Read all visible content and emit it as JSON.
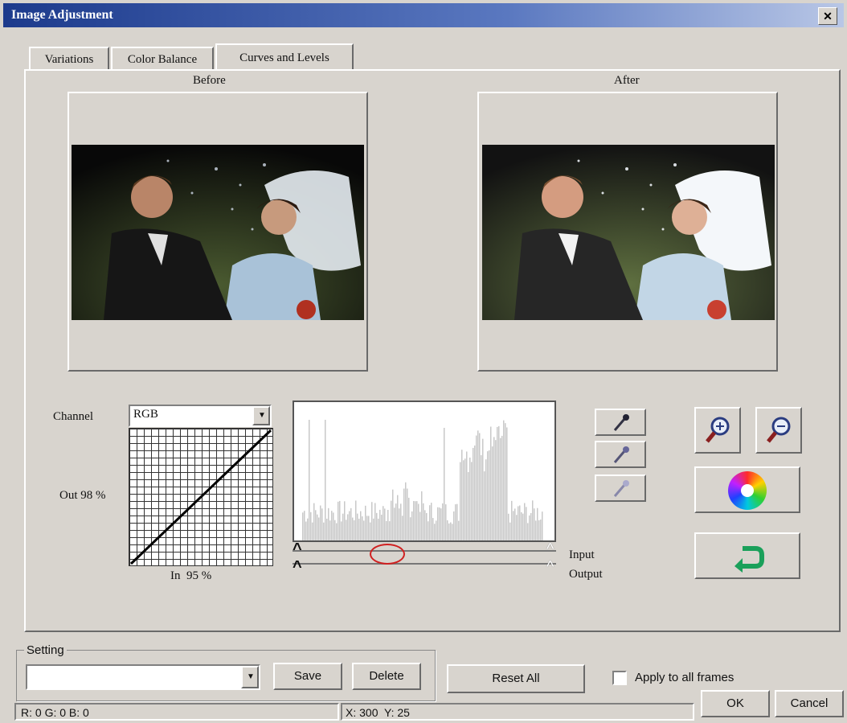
{
  "window": {
    "title": "Image Adjustment",
    "close_glyph": "✕"
  },
  "tabs": [
    {
      "label": "Variations"
    },
    {
      "label": "Color Balance"
    },
    {
      "label": "Curves and Levels"
    }
  ],
  "preview": {
    "before_label": "Before",
    "after_label": "After"
  },
  "curves": {
    "channel_label": "Channel",
    "channel_value": "RGB",
    "out_label": "Out 98 %",
    "in_label": "In  95 %"
  },
  "levels": {
    "input_label": "Input",
    "output_label": "Output",
    "slider_marker": "^"
  },
  "icons": {
    "eyedroppers": [
      "eyedropper-black-icon",
      "eyedropper-gray-icon",
      "eyedropper-white-icon"
    ],
    "zoom_in": "zoom-in-icon",
    "zoom_out": "zoom-out-icon",
    "color_wheel": "color-wheel-icon",
    "undo": "undo-arrow-icon"
  },
  "colors": {
    "title_bar": "#1c3a8c",
    "histogram": "#c8c8c8",
    "highlight": "#d02020",
    "undo": "#1aa05a"
  },
  "setting": {
    "group_label": "Setting",
    "value": "",
    "save_label": "Save",
    "delete_label": "Delete"
  },
  "reset_all_label": "Reset All",
  "apply_all_label": "Apply to all frames",
  "ok_label": "OK",
  "cancel_label": "Cancel",
  "status": {
    "rgb": "R: 0 G: 0 B: 0",
    "coords": "X: 300  Y: 25"
  }
}
